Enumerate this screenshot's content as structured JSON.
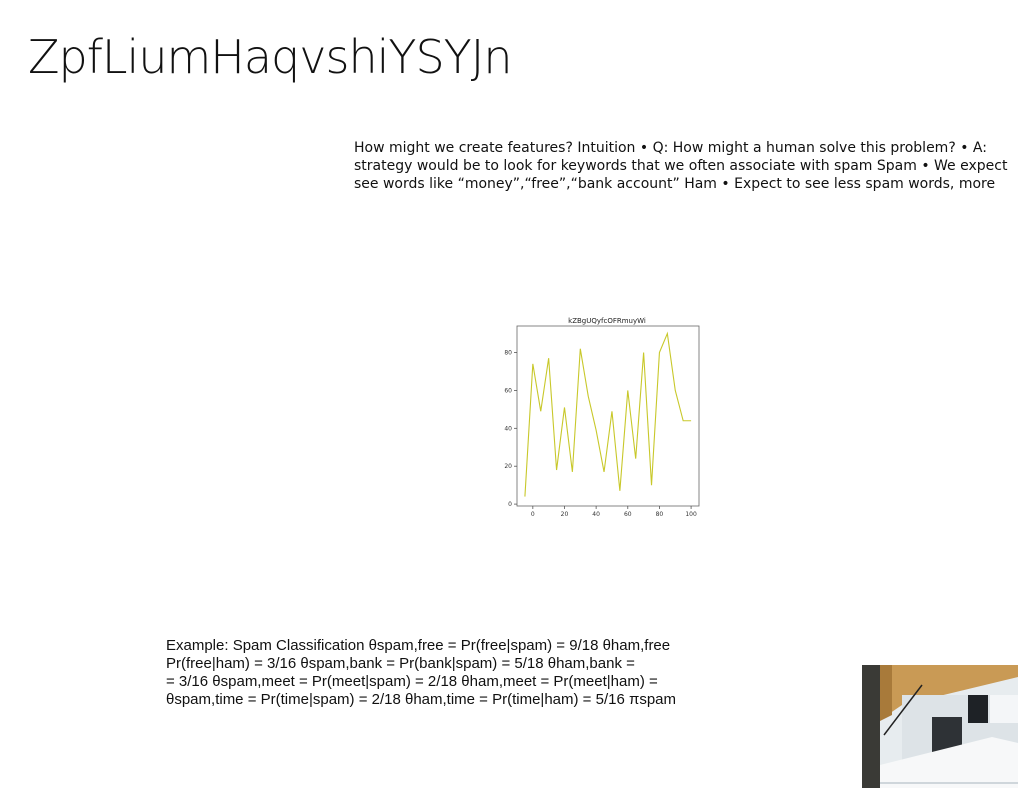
{
  "slide": {
    "title": "ZpfLiumHaqvshiYSYJn",
    "text_lines": [
      "How might we create features? Intuition • Q: How might a human solve this problem? • A:",
      "strategy would be to look for keywords that we often associate with spam Spam • We expect",
      "see words like “money”,“free”,“bank account” Ham • Expect to see less spam words, more"
    ],
    "example_lines": [
      "Example: Spam Classification θspam,free = Pr(free|spam) = 9/18 θham,free",
      "Pr(free|ham) = 3/16 θspam,bank = Pr(bank|spam) = 5/18 θham,bank =",
      "= 3/16 θspam,meet = Pr(meet|spam) = 2/18 θham,meet = Pr(meet|ham) =",
      "θspam,time = Pr(time|spam) = 2/18 θham,time = Pr(time|ham) = 5/16 πspam"
    ]
  },
  "chart_data": {
    "type": "line",
    "title": "kZBgUQyfcOFRmuyWi",
    "xlabel": "",
    "ylabel": "",
    "x": [
      -5,
      0,
      5,
      10,
      15,
      20,
      25,
      30,
      35,
      40,
      45,
      50,
      55,
      60,
      65,
      70,
      75,
      80,
      85,
      90,
      95,
      100
    ],
    "series": [
      {
        "values": [
          4,
          74,
          49,
          77,
          18,
          51,
          17,
          82,
          57,
          39,
          17,
          49,
          7,
          60,
          24,
          80,
          10,
          80,
          90,
          60,
          44,
          44
        ],
        "color": "#c8c82a"
      }
    ],
    "xlim": [
      -10,
      105
    ],
    "ylim": [
      -1,
      94
    ],
    "xticks": [
      0,
      20,
      40,
      60,
      80,
      100
    ],
    "yticks": [
      0,
      20,
      40,
      60,
      80
    ],
    "grid": false,
    "legend": "none"
  },
  "colors": {
    "line": "#c8c82a",
    "axis": "#555555"
  }
}
